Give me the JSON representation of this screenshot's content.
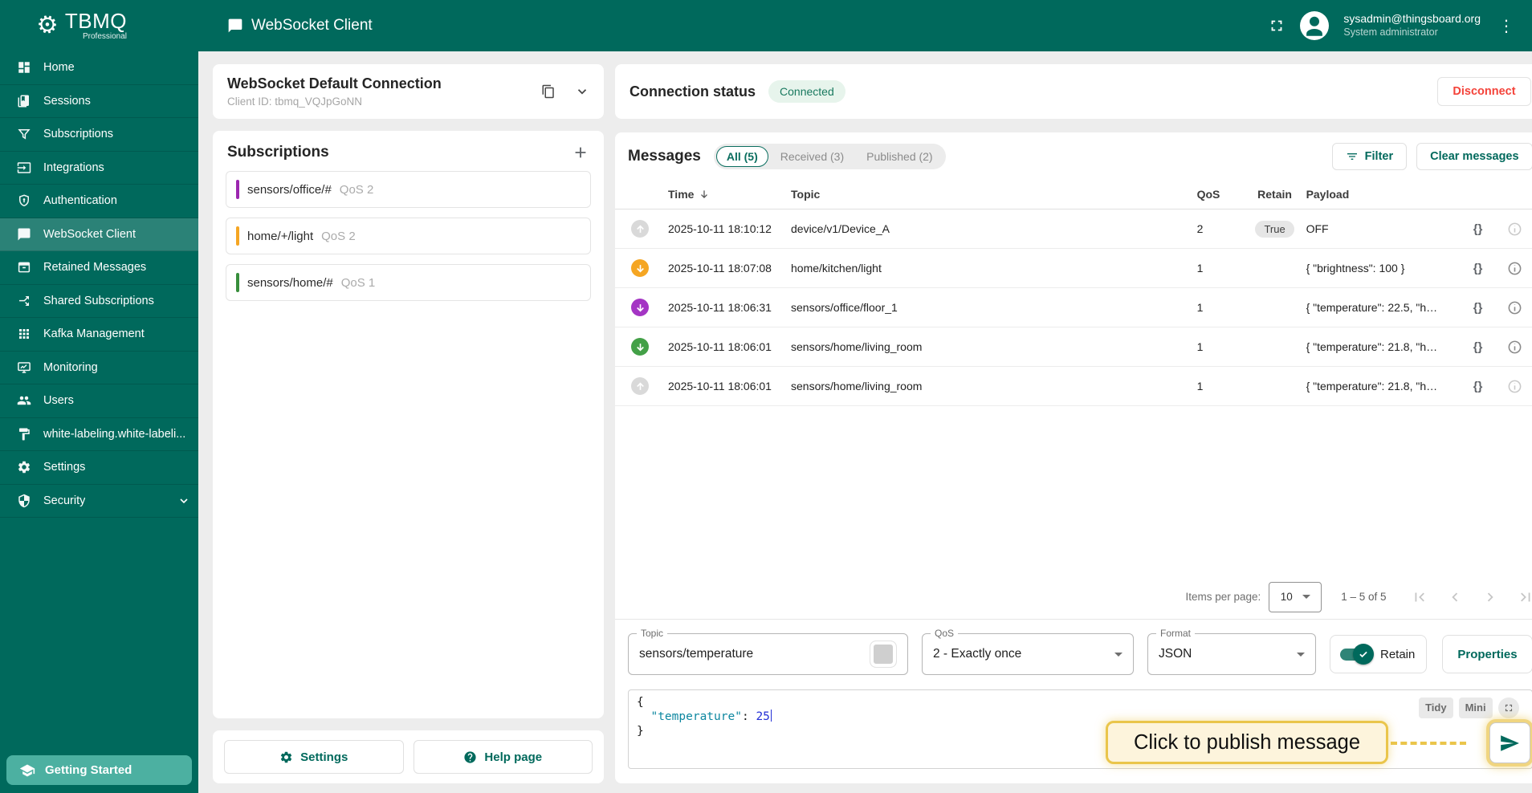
{
  "header": {
    "logo_text": "TBMQ",
    "logo_sub": "Professional",
    "title": "WebSocket Client",
    "user_email": "sysadmin@thingsboard.org",
    "user_role": "System administrator"
  },
  "sidebar": {
    "items": [
      {
        "label": "Home"
      },
      {
        "label": "Sessions"
      },
      {
        "label": "Subscriptions"
      },
      {
        "label": "Integrations"
      },
      {
        "label": "Authentication"
      },
      {
        "label": "WebSocket Client"
      },
      {
        "label": "Retained Messages"
      },
      {
        "label": "Shared Subscriptions"
      },
      {
        "label": "Kafka Management"
      },
      {
        "label": "Monitoring"
      },
      {
        "label": "Users"
      },
      {
        "label": "white-labeling.white-labeli..."
      },
      {
        "label": "Settings"
      },
      {
        "label": "Security"
      }
    ],
    "footer_label": "Getting Started"
  },
  "connection_card": {
    "title": "WebSocket Default Connection",
    "subtitle": "Client ID: tbmq_VQJpGoNN"
  },
  "subscriptions_card": {
    "title": "Subscriptions",
    "items": [
      {
        "topic": "sensors/office/#",
        "qos": "QoS 2",
        "color": "#9c27b0"
      },
      {
        "topic": "home/+/light",
        "qos": "QoS 2",
        "color": "#f5a623"
      },
      {
        "topic": "sensors/home/#",
        "qos": "QoS 1",
        "color": "#388e3c"
      }
    ]
  },
  "left_footer": {
    "settings_label": "Settings",
    "help_label": "Help page"
  },
  "status_card": {
    "title": "Connection status",
    "badge": "Connected",
    "disconnect_label": "Disconnect"
  },
  "messages_card": {
    "title": "Messages",
    "tabs": [
      {
        "label": "All (5)"
      },
      {
        "label": "Received (3)"
      },
      {
        "label": "Published (2)"
      }
    ],
    "filter_label": "Filter",
    "clear_label": "Clear messages",
    "columns": {
      "time": "Time",
      "topic": "Topic",
      "qos": "QoS",
      "retain": "Retain",
      "payload": "Payload"
    },
    "rows": [
      {
        "direction": "published",
        "icon_color": "#d9d9d9",
        "time": "2025-10-11 18:10:12",
        "topic": "device/v1/Device_A",
        "qos": "2",
        "retain": "True",
        "payload": "OFF"
      },
      {
        "direction": "received",
        "icon_color": "#f5a623",
        "time": "2025-10-11 18:07:08",
        "topic": "home/kitchen/light",
        "qos": "1",
        "retain": "",
        "payload": "{ \"brightness\": 100 }"
      },
      {
        "direction": "received",
        "icon_color": "#a435c4",
        "time": "2025-10-11 18:06:31",
        "topic": "sensors/office/floor_1",
        "qos": "1",
        "retain": "",
        "payload": "{ \"temperature\": 22.5, \"h…"
      },
      {
        "direction": "received",
        "icon_color": "#43a047",
        "time": "2025-10-11 18:06:01",
        "topic": "sensors/home/living_room",
        "qos": "1",
        "retain": "",
        "payload": "{ \"temperature\": 21.8, \"h…"
      },
      {
        "direction": "published",
        "icon_color": "#d9d9d9",
        "time": "2025-10-11 18:06:01",
        "topic": "sensors/home/living_room",
        "qos": "1",
        "retain": "",
        "payload": "{ \"temperature\": 21.8, \"h…"
      }
    ],
    "pagination": {
      "items_per_page_label": "Items per page:",
      "items_per_page": "10",
      "range": "1 – 5 of 5"
    }
  },
  "publish": {
    "topic_label": "Topic",
    "topic_value": "sensors/temperature",
    "qos_label": "QoS",
    "qos_value": "2 - Exactly once",
    "format_label": "Format",
    "format_value": "JSON",
    "retain_label": "Retain",
    "properties_label": "Properties",
    "editor": {
      "tidy_label": "Tidy",
      "mini_label": "Mini",
      "open_brace": "{",
      "key": "\"temperature\"",
      "separator": ": ",
      "value": "25",
      "close_brace": "}"
    },
    "tooltip_text": "Click to publish message"
  },
  "colors": {
    "primary": "#00695c",
    "danger": "#f44336",
    "tooltip_accent": "#eac54b"
  }
}
